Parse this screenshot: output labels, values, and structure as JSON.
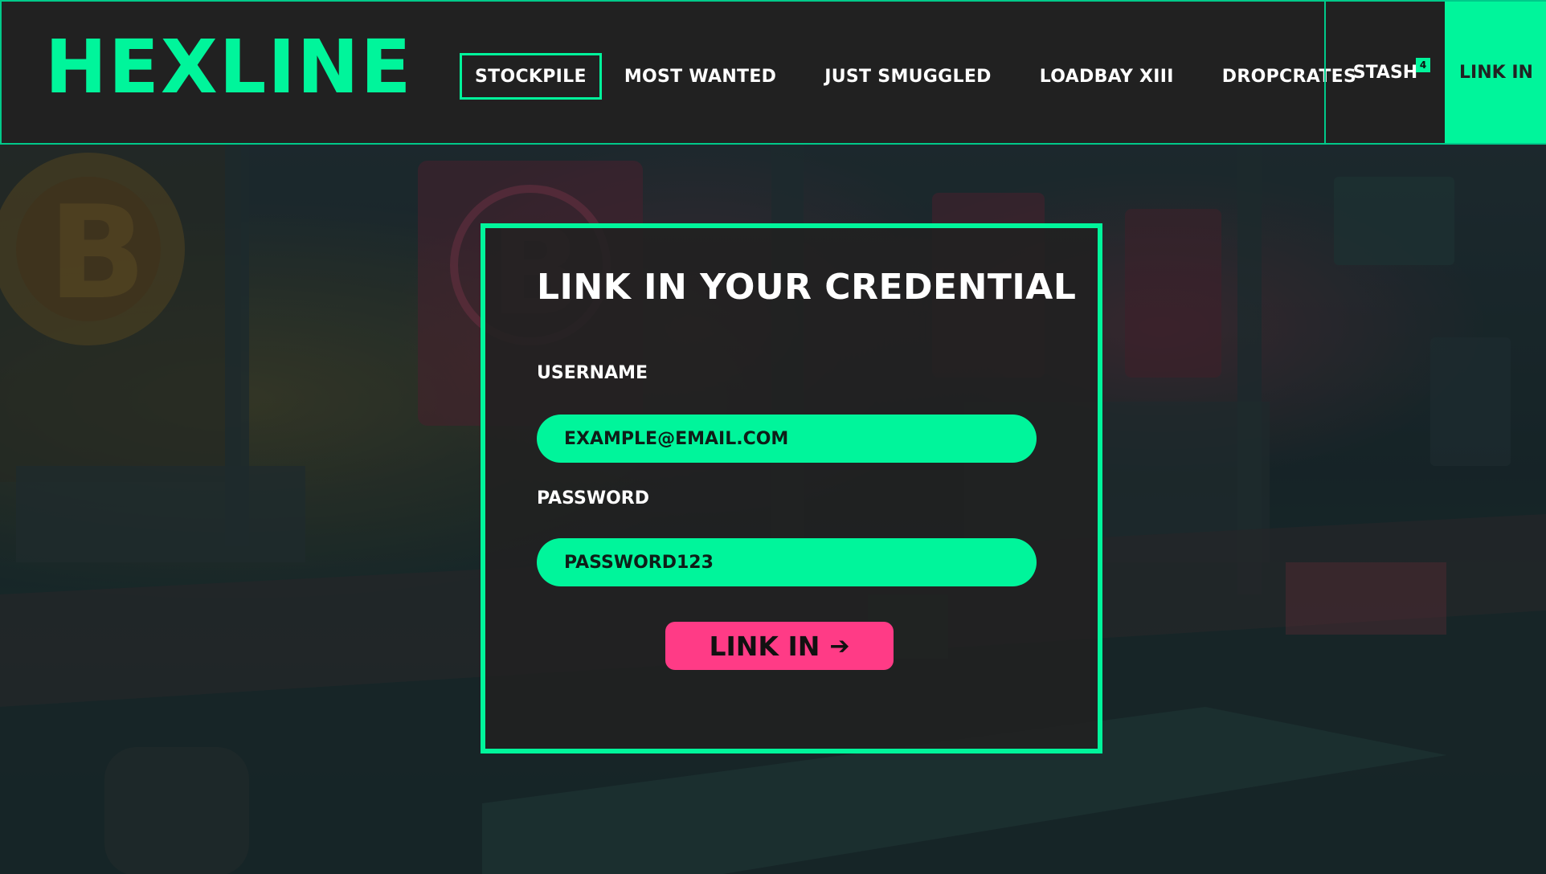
{
  "header": {
    "logo": "HEXLINE",
    "nav": [
      {
        "label": "STOCKPILE",
        "active": true
      },
      {
        "label": "MOST WANTED"
      },
      {
        "label": "JUST SMUGGLED"
      },
      {
        "label": "LOADBAY XIII"
      },
      {
        "label": "DROPCRATES"
      }
    ],
    "stash": {
      "label": "STASH",
      "count": "4"
    },
    "link_in": "LINK IN"
  },
  "login": {
    "title": "LINK IN YOUR CREDENTIAL",
    "username_label": "USERNAME",
    "username_value": "EXAMPLE@EMAIL.COM",
    "password_label": "PASSWORD",
    "password_value": "PASSWORD123",
    "submit_label": "LINK IN",
    "submit_icon": "arrow-right-icon"
  },
  "colors": {
    "accent": "#00f59b",
    "header_bg": "#212121",
    "button": "#ff3b86"
  }
}
